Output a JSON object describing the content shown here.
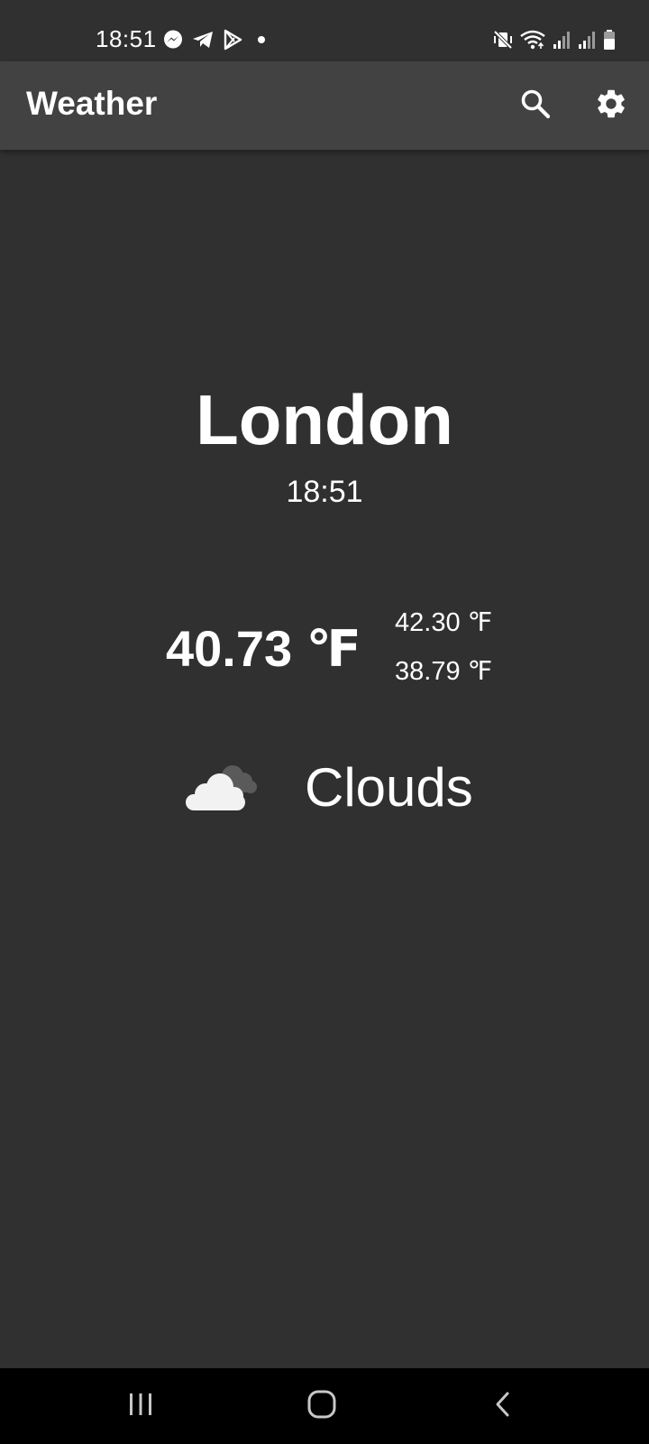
{
  "status_bar": {
    "time": "18:51",
    "left_icons": [
      "messenger-icon",
      "telegram-icon",
      "play-store-icon",
      "notification-dot-icon"
    ],
    "right_icons": [
      "mute-vibrate-icon",
      "wifi-icon",
      "signal-icon",
      "signal-icon",
      "battery-icon"
    ]
  },
  "app_bar": {
    "title": "Weather",
    "actions": [
      "search-icon",
      "gear-icon"
    ]
  },
  "weather": {
    "city": "London",
    "time": "18:51",
    "temperature": "40.73 ℉",
    "temp_max": "42.30 ℉",
    "temp_min": "38.79 ℉",
    "condition": "Clouds",
    "condition_icon": "clouds-icon"
  },
  "nav_bar": {
    "buttons": [
      "recents-icon",
      "home-icon",
      "back-icon"
    ]
  },
  "colors": {
    "background": "#303030",
    "app_bar": "#424242",
    "nav_bar": "#000000",
    "text": "#ffffff"
  }
}
